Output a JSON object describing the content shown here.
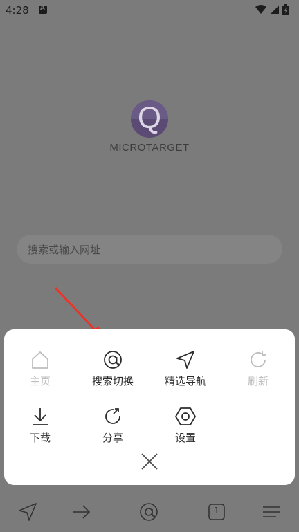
{
  "status_bar": {
    "time": "4:28"
  },
  "logo": {
    "text": "MICROTARGET",
    "letter": "Q"
  },
  "search": {
    "placeholder": "搜索或输入网址"
  },
  "menu": {
    "row1": [
      {
        "label": "主页",
        "icon": "home-icon",
        "enabled": false
      },
      {
        "label": "搜索切换",
        "icon": "at-icon",
        "enabled": true
      },
      {
        "label": "精选导航",
        "icon": "navigation-icon",
        "enabled": true
      },
      {
        "label": "刷新",
        "icon": "refresh-icon",
        "enabled": false
      }
    ],
    "row2": [
      {
        "label": "下载",
        "icon": "download-icon",
        "enabled": true
      },
      {
        "label": "分享",
        "icon": "share-icon",
        "enabled": true
      },
      {
        "label": "设置",
        "icon": "settings-icon",
        "enabled": true
      }
    ],
    "close_icon": "close-icon"
  },
  "bottom_bar": {
    "tab_count": "1",
    "icons": [
      "navigation-icon",
      "forward-arrow-icon",
      "at-icon",
      "tabs-icon",
      "menu-icon"
    ]
  },
  "colors": {
    "overlay": "#7b7b7b",
    "panel": "#ffffff",
    "arrow": "#e8352a",
    "logo": "#5a4a74"
  }
}
